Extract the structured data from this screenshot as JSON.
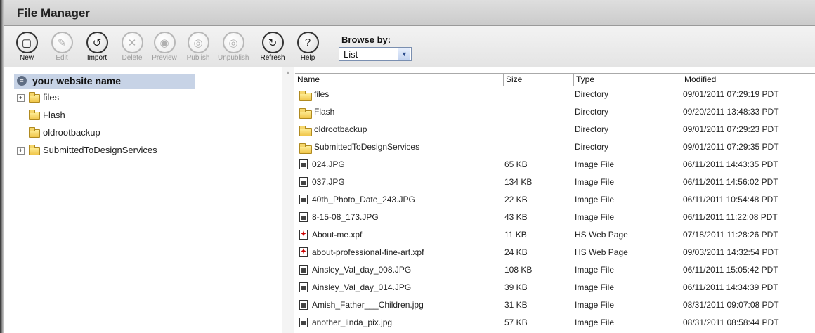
{
  "title": "File Manager",
  "toolbar": {
    "buttons": [
      {
        "label": "New",
        "glyph": "▢",
        "enabled": true
      },
      {
        "label": "Edit",
        "glyph": "✎",
        "enabled": false
      },
      {
        "label": "Import",
        "glyph": "↺",
        "enabled": true
      },
      {
        "label": "Delete",
        "glyph": "✕",
        "enabled": false
      },
      {
        "label": "Preview",
        "glyph": "◉",
        "enabled": false
      },
      {
        "label": "Publish",
        "glyph": "◎",
        "enabled": false
      },
      {
        "label": "Unpublish",
        "glyph": "◎",
        "enabled": false
      },
      {
        "label": "Refresh",
        "glyph": "↻",
        "enabled": true
      },
      {
        "label": "Help",
        "glyph": "?",
        "enabled": true
      }
    ],
    "browse_label": "Browse by:",
    "browse_value": "List"
  },
  "tree": {
    "root": "your website name",
    "items": [
      {
        "label": "files",
        "expandable": true
      },
      {
        "label": "Flash",
        "expandable": false
      },
      {
        "label": "oldrootbackup",
        "expandable": false
      },
      {
        "label": "SubmittedToDesignServices",
        "expandable": true
      }
    ]
  },
  "list": {
    "columns": {
      "name": "Name",
      "size": "Size",
      "type": "Type",
      "modified": "Modified"
    },
    "rows": [
      {
        "icon": "folder",
        "name": "files",
        "size": "",
        "type": "Directory",
        "modified": "09/01/2011 07:29:19 PDT"
      },
      {
        "icon": "folder",
        "name": "Flash",
        "size": "",
        "type": "Directory",
        "modified": "09/20/2011 13:48:33 PDT"
      },
      {
        "icon": "folder",
        "name": "oldrootbackup",
        "size": "",
        "type": "Directory",
        "modified": "09/01/2011 07:29:23 PDT"
      },
      {
        "icon": "folder",
        "name": "SubmittedToDesignServices",
        "size": "",
        "type": "Directory",
        "modified": "09/01/2011 07:29:35 PDT"
      },
      {
        "icon": "image",
        "name": "024.JPG",
        "size": "65 KB",
        "type": "Image File",
        "modified": "06/11/2011 14:43:35 PDT"
      },
      {
        "icon": "image",
        "name": "037.JPG",
        "size": "134 KB",
        "type": "Image File",
        "modified": "06/11/2011 14:56:02 PDT"
      },
      {
        "icon": "image",
        "name": "40th_Photo_Date_243.JPG",
        "size": "22 KB",
        "type": "Image File",
        "modified": "06/11/2011 10:54:48 PDT"
      },
      {
        "icon": "image",
        "name": "8-15-08_173.JPG",
        "size": "43 KB",
        "type": "Image File",
        "modified": "06/11/2011 11:22:08 PDT"
      },
      {
        "icon": "web",
        "name": "About-me.xpf",
        "size": "11 KB",
        "type": "HS Web Page",
        "modified": "07/18/2011 11:28:26 PDT"
      },
      {
        "icon": "web",
        "name": "about-professional-fine-art.xpf",
        "size": "24 KB",
        "type": "HS Web Page",
        "modified": "09/03/2011 14:32:54 PDT"
      },
      {
        "icon": "image",
        "name": "Ainsley_Val_day_008.JPG",
        "size": "108 KB",
        "type": "Image File",
        "modified": "06/11/2011 15:05:42 PDT"
      },
      {
        "icon": "image",
        "name": "Ainsley_Val_day_014.JPG",
        "size": "39 KB",
        "type": "Image File",
        "modified": "06/11/2011 14:34:39 PDT"
      },
      {
        "icon": "image",
        "name": "Amish_Father___Children.jpg",
        "size": "31 KB",
        "type": "Image File",
        "modified": "08/31/2011 09:07:08 PDT"
      },
      {
        "icon": "image",
        "name": "another_linda_pix.jpg",
        "size": "57 KB",
        "type": "Image File",
        "modified": "08/31/2011 08:58:44 PDT"
      }
    ]
  }
}
